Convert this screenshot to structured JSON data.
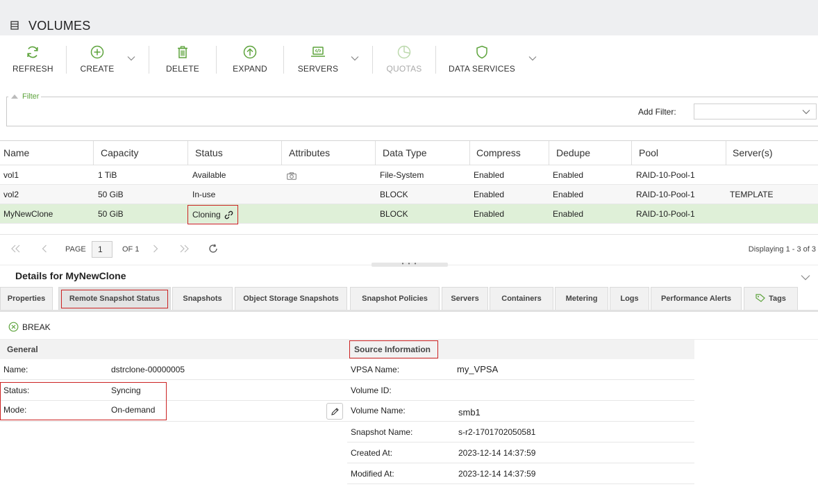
{
  "page": {
    "title": "VOLUMES"
  },
  "toolbar": {
    "refresh": "REFRESH",
    "create": "CREATE",
    "delete": "DELETE",
    "expand": "EXPAND",
    "servers": "SERVERS",
    "quotas": "QUOTAS",
    "data_services": "DATA SERVICES"
  },
  "filter": {
    "legend": "Filter",
    "add_label": "Add Filter:",
    "add_value": ""
  },
  "grid": {
    "columns": [
      "Name",
      "Capacity",
      "Status",
      "Attributes",
      "Data Type",
      "Compress",
      "Dedupe",
      "Pool",
      "Server(s)"
    ],
    "rows": [
      {
        "name": "vol1",
        "capacity": "1 TiB",
        "status": "Available",
        "attr_icon": "camera-icon",
        "data_type": "File-System",
        "compress": "Enabled",
        "dedupe": "Enabled",
        "pool": "RAID-10-Pool-1",
        "servers": ""
      },
      {
        "name": "vol2",
        "capacity": "50 GiB",
        "status": "In-use",
        "attr_icon": "",
        "data_type": "BLOCK",
        "compress": "Enabled",
        "dedupe": "Enabled",
        "pool": "RAID-10-Pool-1",
        "servers": "TEMPLATE"
      },
      {
        "name": "MyNewClone",
        "capacity": "50 GiB",
        "status": "Cloning",
        "attr_icon": "",
        "data_type": "BLOCK",
        "compress": "Enabled",
        "dedupe": "Enabled",
        "pool": "RAID-10-Pool-1",
        "servers": ""
      }
    ]
  },
  "pager": {
    "page_label": "PAGE",
    "page_value": "1",
    "of_label": "OF 1",
    "displaying": "Displaying 1 - 3 of 3"
  },
  "details": {
    "title": "Details for MyNewClone",
    "tabs": [
      "Properties",
      "Remote Snapshot Status",
      "Snapshots",
      "Object Storage Snapshots",
      "Snapshot Policies",
      "Servers",
      "Containers",
      "Metering",
      "Logs",
      "Performance Alerts",
      "Tags"
    ],
    "active_tab": "Remote Snapshot Status",
    "break_label": "BREAK",
    "general": {
      "header": "General",
      "name_label": "Name:",
      "name_value": "dstrclone-00000005",
      "status_label": "Status:",
      "status_value": "Syncing",
      "mode_label": "Mode:",
      "mode_value": "On-demand"
    },
    "source": {
      "header": "Source Information",
      "vpsa_label": "VPSA Name:",
      "vpsa_value": "my_VPSA",
      "volid_label": "Volume ID:",
      "volid_value": "",
      "volname_label": "Volume Name:",
      "volname_value": "smb1",
      "snapname_label": "Snapshot Name:",
      "snapname_value": "s-r2-1701702050581",
      "created_label": "Created At:",
      "created_value": "2023-12-14 14:37:59",
      "modified_label": "Modified At:",
      "modified_value": "2023-12-14 14:37:59"
    }
  },
  "colors": {
    "accent_green": "#5da33c",
    "selected_row": "#dff0d8",
    "highlight_red": "#cc2222"
  }
}
